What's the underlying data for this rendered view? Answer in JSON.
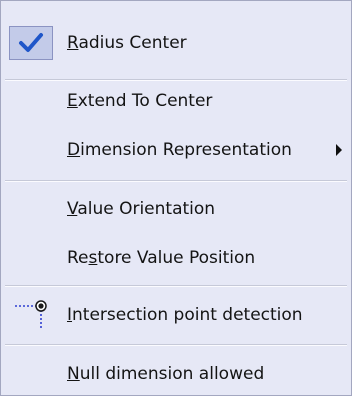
{
  "menu": {
    "items": [
      {
        "mnemonic": "R",
        "rest": "adius Center",
        "checked": true,
        "icon": "checkmark-icon"
      },
      {
        "mnemonic": "E",
        "rest": "xtend To Center"
      },
      {
        "mnemonic": "D",
        "rest": "imension Representation",
        "submenu": true,
        "icon": "submenu-arrow-icon"
      },
      {
        "mnemonic": "V",
        "rest": "alue Orientation"
      },
      {
        "before": "Re",
        "mnemonic": "s",
        "rest": "tore Value Position"
      },
      {
        "mnemonic": "I",
        "rest": "ntersection point detection",
        "icon": "intersection-point-icon"
      },
      {
        "mnemonic": "N",
        "rest": "ull dimension allowed"
      }
    ]
  },
  "colors": {
    "menu_background": "#e6e8f6",
    "check_highlight": "#c3cbe9",
    "check_mark": "#1f56c9",
    "icon_dots": "#2f3fd1"
  }
}
